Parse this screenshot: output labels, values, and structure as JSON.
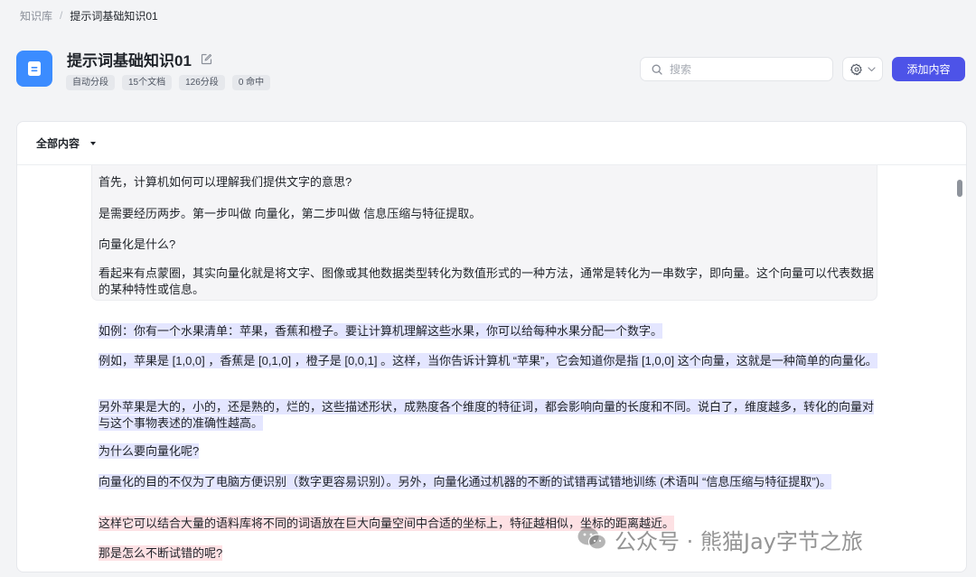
{
  "breadcrumb": {
    "root": "知识库",
    "separator": "/",
    "current": "提示词基础知识01"
  },
  "header": {
    "title": "提示词基础知识01",
    "icon": "document-icon",
    "tags": [
      "自动分段",
      "15个文档",
      "126分段",
      "0 命中"
    ]
  },
  "toolbar": {
    "search_placeholder": "搜索",
    "add_label": "添加内容"
  },
  "filter": {
    "selected": "全部内容"
  },
  "segments": {
    "s1": "首先，计算机如何可以理解我们提供文字的意思?",
    "s2": "是需要经历两步。第一步叫做 向量化，第二步叫做 信息压缩与特征提取。",
    "s3": "向量化是什么?",
    "s4": "看起来有点蒙圈，其实向量化就是将文字、图像或其他数据类型转化为数值形式的一种方法，通常是转化为一串数字，即向量。这个向量可以代表数据的某种特性或信息。",
    "s5": "如例：你有一个水果清单：苹果，香蕉和橙子。要让计算机理解这些水果，你可以给每种水果分配一个数字。",
    "s6": "例如，苹果是 [1,0,0] ，香蕉是 [0,1,0] ，橙子是 [0,0,1] 。这样，当你告诉计算机 “苹果”，它会知道你是指 [1,0,0] 这个向量，这就是一种简单的向量化。",
    "s7": "另外苹果是大的，小的，还是熟的，烂的，这些描述形状，成熟度各个维度的特征词，都会影响向量的长度和不同。说白了，维度越多，转化的向量对与这个事物表述的准确性越高。",
    "s8": "为什么要向量化呢?",
    "s9": "向量化的目的不仅为了电脑方便识别（数字更容易识别）。另外，向量化通过机器的不断的试错再试错地训练 (术语叫 “信息压缩与特征提取”)。",
    "s10": "这样它可以结合大量的语料库将不同的词语放在巨大向量空间中合适的坐标上，特征越相似，坐标的距离越近。",
    "s11": "那是怎么不断试错的呢?"
  },
  "colors": {
    "accent": "#4d53e8",
    "kb_icon": "#3b8cff",
    "highlight_blue": "#e4e6ff",
    "highlight_pink": "#fde1e4"
  },
  "watermark": {
    "text": "公众号 · 熊猫Jay字节之旅"
  }
}
